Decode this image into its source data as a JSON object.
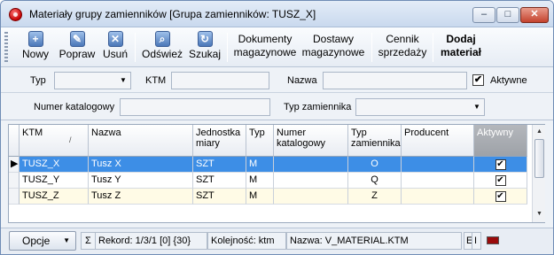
{
  "window": {
    "title": "Materiały grupy zamienników [Grupa zamienników: TUSZ_X]",
    "controls": {
      "minimize": "–",
      "maximize": "□",
      "close": "✕"
    }
  },
  "toolbar": {
    "new_label": "Nowy",
    "edit_label": "Popraw",
    "delete_label": "Usuń",
    "refresh_label": "Odśwież",
    "search_label": "Szukaj",
    "documents_line1": "Dokumenty",
    "documents_line2": "magazynowe",
    "deliveries_line1": "Dostawy",
    "deliveries_line2": "magazynowe",
    "pricelist_line1": "Cennik",
    "pricelist_line2": "sprzedaży",
    "add_material_line1": "Dodaj",
    "add_material_line2": "materiał",
    "icons": {
      "new": "+",
      "edit": "✎",
      "delete": "✕",
      "refresh": "⌕",
      "search": "↻"
    }
  },
  "filters": {
    "typ_label": "Typ",
    "typ_value": "",
    "ktm_label": "KTM",
    "ktm_value": "",
    "nazwa_label": "Nazwa",
    "nazwa_value": "",
    "aktywne_label": "Aktywne",
    "aktywne_checked": true,
    "catalog_label": "Numer katalogowy",
    "catalog_value": "",
    "replacement_type_label": "Typ zamiennika",
    "replacement_type_value": ""
  },
  "grid": {
    "columns": {
      "ktm": "KTM",
      "nazwa": "Nazwa",
      "jednostka_1": "Jednostka",
      "jednostka_2": "miary",
      "typ": "Typ",
      "numer_1": "Numer",
      "numer_2": "katalogowy",
      "typzam_1": "Typ",
      "typzam_2": "zamiennika",
      "producent": "Producent",
      "aktywny": "Aktywny"
    },
    "sort_indicator": "/",
    "rows": [
      {
        "ktm": "TUSZ_X",
        "nazwa": "Tusz X",
        "jm": "SZT",
        "typ": "M",
        "numer": "",
        "typzam": "O",
        "producent": "",
        "aktywny": "✔"
      },
      {
        "ktm": "TUSZ_Y",
        "nazwa": "Tusz Y",
        "jm": "SZT",
        "typ": "M",
        "numer": "",
        "typzam": "Q",
        "producent": "",
        "aktywny": "✔"
      },
      {
        "ktm": "TUSZ_Z",
        "nazwa": "Tusz Z",
        "jm": "SZT",
        "typ": "M",
        "numer": "",
        "typzam": "Z",
        "producent": "",
        "aktywny": "✔"
      }
    ],
    "current_row_marker": "▶"
  },
  "statusbar": {
    "options_label": "Opcje",
    "sigma": "Σ",
    "record": "Rekord: 1/3/1",
    "bracket_a": "[0]",
    "bracket_b": "{30}",
    "order": "Kolejność: ktm",
    "name": "Nazwa: V_MATERIAL.KTM",
    "mode_e": "E",
    "mode_i": "I"
  }
}
